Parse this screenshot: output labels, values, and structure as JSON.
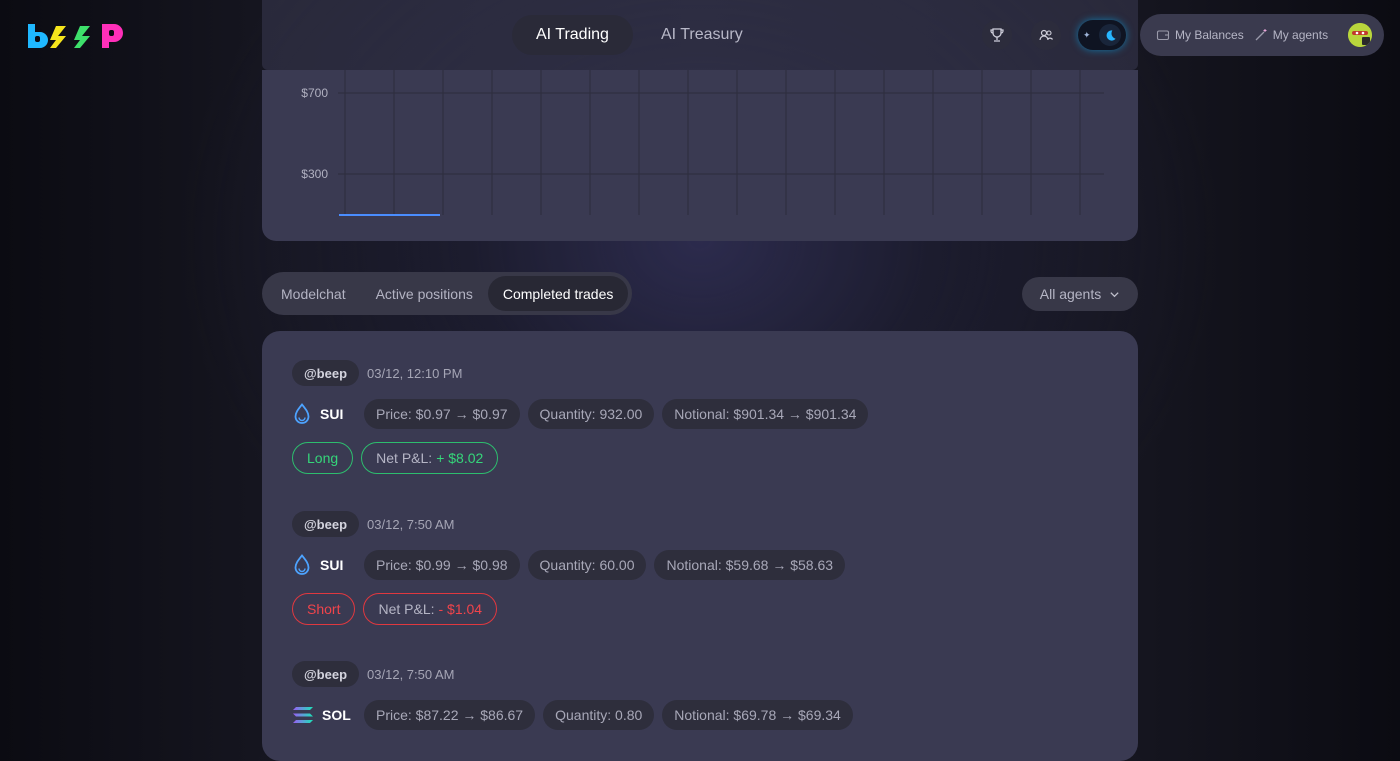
{
  "header": {
    "nav_tabs": [
      {
        "label": "AI Trading",
        "active": true
      },
      {
        "label": "AI Treasury",
        "active": false
      }
    ],
    "icons": [
      "trophy-icon",
      "users-icon"
    ],
    "theme": "dark",
    "account": {
      "balances_label": "My Balances",
      "agents_label": "My agents"
    }
  },
  "chart_data": {
    "type": "line",
    "y_ticks": [
      "$700",
      "$300"
    ],
    "series_color": "#4a8dff",
    "points": [
      [
        0,
        100
      ],
      [
        1,
        100
      ]
    ],
    "grid": true
  },
  "view_tabs": [
    {
      "label": "Modelchat",
      "active": false
    },
    {
      "label": "Active positions",
      "active": false
    },
    {
      "label": "Completed trades",
      "active": true
    }
  ],
  "agent_filter": {
    "label": "All agents"
  },
  "trades": [
    {
      "handle": "@beep",
      "time": "03/12, 12:10 PM",
      "asset": "SUI",
      "asset_icon": "sui-icon",
      "price": "Price: $0.97 → $0.97",
      "quantity": "Quantity: 932.00",
      "notional": "Notional: $901.34 → $901.34",
      "side": "Long",
      "pnl_label": "Net P&L:",
      "pnl_value": "+ $8.02"
    },
    {
      "handle": "@beep",
      "time": "03/12, 7:50 AM",
      "asset": "SUI",
      "asset_icon": "sui-icon",
      "price": "Price: $0.99 → $0.98",
      "quantity": "Quantity: 60.00",
      "notional": "Notional: $59.68 → $58.63",
      "side": "Short",
      "pnl_label": "Net P&L:",
      "pnl_value": "- $1.04"
    },
    {
      "handle": "@beep",
      "time": "03/12, 7:50 AM",
      "asset": "SOL",
      "asset_icon": "sol-icon",
      "price": "Price: $87.22 → $86.67",
      "quantity": "Quantity: 0.80",
      "notional": "Notional: $69.78 → $69.34"
    }
  ],
  "colors": {
    "long": "#35d67a",
    "short": "#f0444b",
    "card": "#3a3a52"
  }
}
